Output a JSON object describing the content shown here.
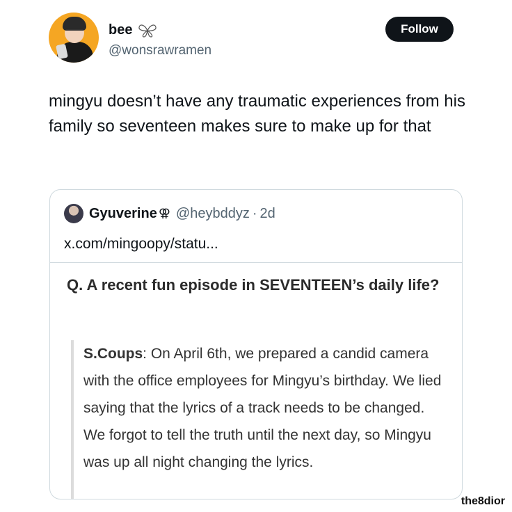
{
  "author": {
    "display_name": "bee",
    "handle": "@wonsrawramen",
    "badge_icon": "butterfly-wings-icon"
  },
  "follow_label": "Follow",
  "tweet_text": "mingyu doesn’t have any traumatic experiences from his family so seventeen makes sure to make up for that",
  "quote": {
    "display_name": "Gyuverine",
    "name_emoji": "⚢",
    "handle": "@heybddyz",
    "separator": "·",
    "time": "2d",
    "link": "x.com/mingoopy/statu...",
    "question": "Q. A recent fun episode in SEVENTEEN’s daily life?",
    "speaker": "S.Coups",
    "answer": ": On April 6th, we prepared a candid camera with the office employees for Mingyu’s birthday. We lied saying that the lyrics of a track needs to be changed. We forgot to tell the truth until the next day, so Mingyu was up all night changing the lyrics."
  },
  "watermark": "the8dior"
}
